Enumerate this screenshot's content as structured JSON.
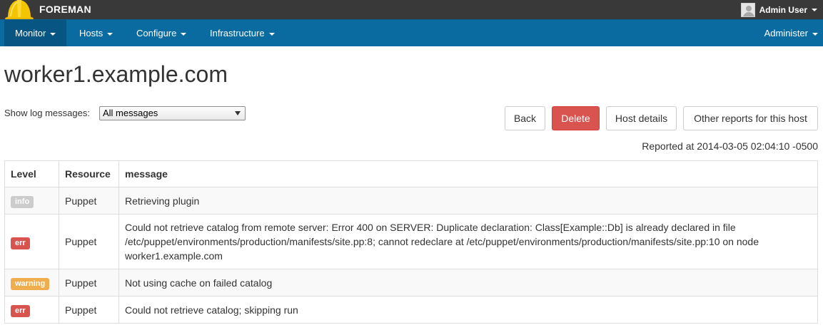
{
  "app": {
    "brand": "FOREMAN"
  },
  "user": {
    "name": "Admin User"
  },
  "nav": {
    "items": [
      {
        "label": "Monitor"
      },
      {
        "label": "Hosts"
      },
      {
        "label": "Configure"
      },
      {
        "label": "Infrastructure"
      }
    ],
    "right": {
      "label": "Administer"
    }
  },
  "page": {
    "title": "worker1.example.com"
  },
  "filter": {
    "label": "Show log messages:",
    "selected": "All messages"
  },
  "buttons": {
    "back": "Back",
    "delete": "Delete",
    "host_details": "Host details",
    "other_reports": "Other reports for this host"
  },
  "reported": "Reported at 2014-03-05 02:04:10 -0500",
  "table": {
    "headers": [
      "Level",
      "Resource",
      "message"
    ],
    "rows": [
      {
        "level": "info",
        "resource": "Puppet",
        "message": "Retrieving plugin"
      },
      {
        "level": "err",
        "resource": "Puppet",
        "message": "Could not retrieve catalog from remote server: Error 400 on SERVER: Duplicate declaration: Class[Example::Db] is already declared in file /etc/puppet/environments/production/manifests/site.pp:8; cannot redeclare at /etc/puppet/environments/production/manifests/site.pp:10 on node worker1.example.com"
      },
      {
        "level": "warning",
        "resource": "Puppet",
        "message": "Not using cache on failed catalog"
      },
      {
        "level": "err",
        "resource": "Puppet",
        "message": "Could not retrieve catalog; skipping run"
      }
    ]
  },
  "colors": {
    "topbar": "#393939",
    "navbar": "#0a6ba0",
    "nav_active": "#075582",
    "danger": "#d9534f",
    "warning": "#f0ad4e",
    "info": "#cccccc"
  },
  "icons": {
    "logo": "foreman-hardhat-icon",
    "avatar": "user-avatar-icon",
    "caret": "caret-down-icon"
  }
}
